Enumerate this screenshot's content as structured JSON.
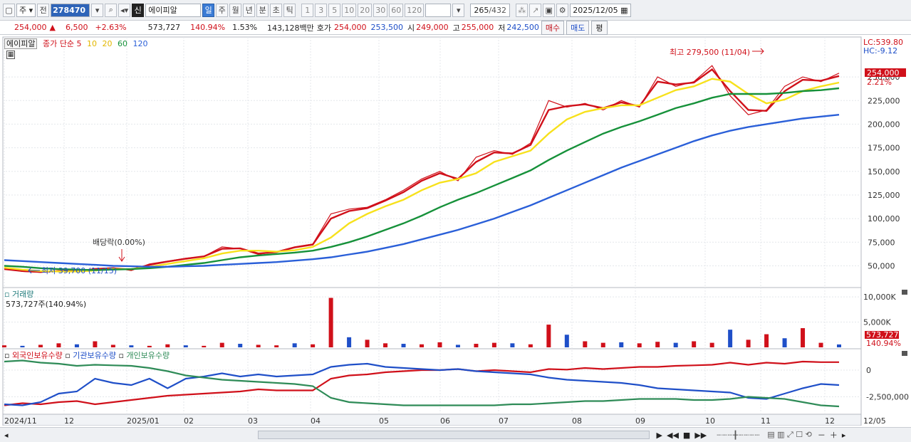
{
  "toolbar": {
    "market": "주",
    "prev_label": "전",
    "code": "278470",
    "stock_badge": "신",
    "stock_name": "에이피알",
    "periods": [
      "일",
      "주",
      "월",
      "년",
      "분",
      "초",
      "틱"
    ],
    "active_period": "일",
    "intervals": [
      "1",
      "3",
      "5",
      "10",
      "20",
      "30",
      "60",
      "120"
    ],
    "count": "265",
    "total": "/432",
    "date": "2025/12/05"
  },
  "info": {
    "price": "254,000",
    "change_arrow": "▲",
    "change": "6,500",
    "change_pct": "+2.63%",
    "volume": "573,727",
    "volume_ratio": "140.94%",
    "turnover": "1.53%",
    "amount": "143,128백만",
    "quote_label": "호가",
    "ask": "254,000",
    "bid": "253,500",
    "open_label": "시",
    "open": "249,000",
    "high_label": "고",
    "high": "255,000",
    "low_label": "저",
    "low": "242,500",
    "buy_button": "매수",
    "sell_button": "매도",
    "eval_button": "평"
  },
  "price_panel": {
    "legend_name": "에이피알",
    "legend_series": "종가 단순",
    "ma_labels": [
      "5",
      "10",
      "20",
      "60",
      "120"
    ],
    "lc_label": "LC:539.80",
    "hc_label": "HC:-9.12",
    "current_price_tag": "254,000",
    "current_pct_tag": "2.21%",
    "high_annotation": "최고 279,500 (11/04)",
    "low_annotation": "최저 39,700 (11/15)",
    "dividend_annotation": "배당락(0.00%)",
    "y_ticks": [
      "250,000",
      "225,000",
      "200,000",
      "175,000",
      "150,000",
      "125,000",
      "100,000",
      "75,000",
      "50,000"
    ]
  },
  "volume_panel": {
    "title": "거래량",
    "value_label": "573,727주(140.94%)",
    "y_ticks": [
      "10,000K",
      "5,000K"
    ],
    "current_tag": "573,727",
    "current_pct_tag": "140.94%"
  },
  "holdings_panel": {
    "series_labels": [
      "외국인보유수량",
      "기관보유수량",
      "개인보유수량"
    ],
    "y_ticks": [
      "0",
      "-2,500,000"
    ]
  },
  "x_axis": {
    "labels": [
      "2024/11",
      "12",
      "2025/01",
      "02",
      "03",
      "04",
      "05",
      "06",
      "07",
      "08",
      "09",
      "10",
      "11",
      "12"
    ],
    "end_label": "12/05"
  },
  "chart_data": [
    {
      "type": "line",
      "name_of_chart": "price",
      "ylim": [
        30000,
        290000
      ],
      "x_months": [
        "2024/11",
        "12",
        "2025/01",
        "02",
        "03",
        "04",
        "05",
        "06",
        "07",
        "08",
        "09",
        "10",
        "11",
        "12"
      ],
      "series": [
        {
          "name": "종가",
          "color": "#d0101a",
          "values": [
            47000,
            44000,
            43000,
            45000,
            44000,
            47000,
            48000,
            45000,
            52000,
            55000,
            58000,
            60000,
            70000,
            68000,
            62000,
            65000,
            70000,
            73000,
            105000,
            110000,
            112000,
            120000,
            130000,
            142000,
            150000,
            140000,
            165000,
            172000,
            168000,
            180000,
            225000,
            218000,
            222000,
            215000,
            225000,
            218000,
            250000,
            240000,
            245000,
            262000,
            230000,
            210000,
            215000,
            240000,
            250000,
            245000,
            254000
          ]
        },
        {
          "name": "5",
          "color": "#d0101a",
          "values": [
            46500,
            44500,
            43500,
            44500,
            44500,
            46500,
            47500,
            46000,
            51000,
            54500,
            57500,
            60000,
            68000,
            68500,
            63000,
            64500,
            69500,
            72500,
            100000,
            108000,
            111000,
            119000,
            128000,
            140000,
            148000,
            142000,
            160000,
            170000,
            169000,
            178000,
            215000,
            219000,
            221000,
            217000,
            223000,
            219000,
            245000,
            242000,
            244000,
            258000,
            235000,
            215000,
            214000,
            235000,
            247000,
            246000,
            251000
          ]
        },
        {
          "name": "20",
          "color": "#f7e11c",
          "values": [
            48000,
            46000,
            44500,
            44000,
            44000,
            45000,
            46500,
            46500,
            49000,
            52000,
            55000,
            58000,
            63000,
            66000,
            66000,
            65000,
            66500,
            70000,
            80000,
            95000,
            105000,
            113000,
            120000,
            130000,
            138000,
            142000,
            148000,
            160000,
            166000,
            172000,
            190000,
            205000,
            213000,
            217000,
            220000,
            220000,
            228000,
            236000,
            240000,
            248000,
            245000,
            232000,
            222000,
            226000,
            235000,
            240000,
            244000
          ]
        },
        {
          "name": "60",
          "color": "#16913a",
          "values": [
            50000,
            49000,
            47500,
            46500,
            46000,
            45500,
            46000,
            46500,
            47500,
            49000,
            51000,
            53000,
            56000,
            59000,
            61000,
            62500,
            64000,
            66000,
            70000,
            75000,
            81000,
            88000,
            95000,
            103000,
            112000,
            120000,
            127000,
            135000,
            143000,
            151000,
            162000,
            172000,
            181000,
            190000,
            197000,
            203000,
            210000,
            217000,
            222000,
            228000,
            232000,
            232000,
            232000,
            233000,
            235000,
            236000,
            238000
          ]
        },
        {
          "name": "120",
          "color": "#2a5fd8",
          "values": [
            56000,
            55000,
            54000,
            53000,
            52000,
            51000,
            50000,
            49500,
            49000,
            49000,
            49500,
            50000,
            51000,
            52000,
            53000,
            54000,
            55500,
            57000,
            59000,
            62000,
            65000,
            69000,
            73000,
            78000,
            83000,
            88000,
            94000,
            100000,
            107000,
            114000,
            122000,
            130000,
            138000,
            146000,
            154000,
            161000,
            168000,
            175000,
            182000,
            188000,
            193000,
            197000,
            200000,
            203000,
            206000,
            208000,
            210000
          ]
        }
      ]
    },
    {
      "type": "bar",
      "name_of_chart": "volume",
      "ylim": [
        0,
        11000
      ],
      "unit": "K",
      "values": [
        400,
        300,
        500,
        800,
        600,
        1200,
        500,
        400,
        300,
        600,
        400,
        300,
        900,
        700,
        500,
        400,
        800,
        600,
        9800,
        2000,
        1500,
        800,
        700,
        600,
        1000,
        500,
        700,
        900,
        800,
        600,
        4500,
        2500,
        1200,
        900,
        1000,
        800,
        1100,
        900,
        1200,
        900,
        3500,
        1500,
        2600,
        1800,
        3800,
        900,
        573
      ]
    },
    {
      "type": "line",
      "name_of_chart": "holdings",
      "ylim": [
        -4000000,
        1000000
      ],
      "series": [
        {
          "name": "외국인보유수량",
          "color": "#d0101a",
          "values": [
            -3300000,
            -3100000,
            -3200000,
            -3000000,
            -2900000,
            -3200000,
            -3000000,
            -2800000,
            -2600000,
            -2400000,
            -2300000,
            -2200000,
            -2100000,
            -2000000,
            -1800000,
            -1900000,
            -1900000,
            -1900000,
            -800000,
            -500000,
            -400000,
            -200000,
            -100000,
            0,
            0,
            100000,
            -100000,
            0,
            -100000,
            -200000,
            100000,
            50000,
            200000,
            100000,
            200000,
            300000,
            300000,
            400000,
            450000,
            500000,
            700000,
            500000,
            700000,
            600000,
            800000,
            750000,
            750000
          ]
        },
        {
          "name": "기관보유수량",
          "color": "#1f4fc8",
          "values": [
            -3200000,
            -3300000,
            -3000000,
            -2200000,
            -2000000,
            -800000,
            -1200000,
            -1400000,
            -800000,
            -1700000,
            -800000,
            -600000,
            -300000,
            -600000,
            -400000,
            -600000,
            -500000,
            -400000,
            300000,
            500000,
            600000,
            300000,
            200000,
            100000,
            0,
            100000,
            -100000,
            -200000,
            -300000,
            -400000,
            -700000,
            -900000,
            -1000000,
            -1100000,
            -1200000,
            -1400000,
            -1700000,
            -1800000,
            -1900000,
            -2000000,
            -2100000,
            -2600000,
            -2700000,
            -2200000,
            -1700000,
            -1300000,
            -1400000
          ]
        },
        {
          "name": "개인보유수량",
          "color": "#2e8b57",
          "values": [
            800000,
            900000,
            700000,
            600000,
            400000,
            500000,
            450000,
            400000,
            200000,
            -100000,
            -500000,
            -700000,
            -900000,
            -1000000,
            -1100000,
            -1200000,
            -1300000,
            -1500000,
            -2600000,
            -3000000,
            -3100000,
            -3200000,
            -3300000,
            -3300000,
            -3300000,
            -3300000,
            -3300000,
            -3300000,
            -3200000,
            -3200000,
            -3100000,
            -3000000,
            -2900000,
            -2900000,
            -2800000,
            -2700000,
            -2700000,
            -2700000,
            -2800000,
            -2800000,
            -2700000,
            -2500000,
            -2600000,
            -2700000,
            -3000000,
            -3300000,
            -3400000
          ]
        }
      ]
    }
  ],
  "bottom": {
    "scroll_icons": [
      "play-icon",
      "rewind-icon",
      "stop-icon",
      "forward-icon"
    ]
  }
}
